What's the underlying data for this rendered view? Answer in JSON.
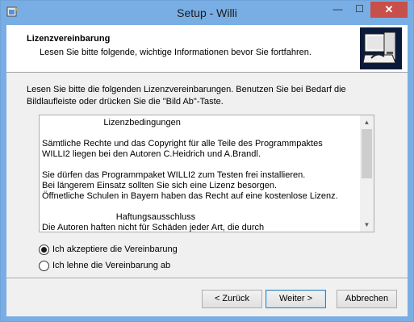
{
  "window": {
    "title": "Setup - Willi",
    "controls": {
      "minimize": "—",
      "maximize": "☐",
      "close": "✕"
    }
  },
  "header": {
    "title": "Lizenzvereinbarung",
    "subtitle": "Lesen Sie bitte folgende, wichtige Informationen bevor Sie fortfahren."
  },
  "instruction": "Lesen Sie bitte die folgenden Lizenzvereinbarungen. Benutzen Sie bei Bedarf die Bildlaufleiste oder drücken Sie die \"Bild Ab\"-Taste.",
  "license": {
    "text": "                         Lizenzbedingungen\n\nSämtliche Rechte und das Copyright für alle Teile des Programmpaktes\nWILLI2 liegen bei den Autoren C.Heidrich und A.Brandl.\n\nSie dürfen das Programmpaket WILLI2 zum Testen frei installieren.\nBei längerem Einsatz sollten Sie sich eine Lizenz besorgen.\nÖffnetliche Schulen in Bayern haben das Recht auf eine kostenlose Lizenz.\n\n                              Haftungsausschluss\nDie Autoren haften nicht für Schäden jeder Art, die durch"
  },
  "options": [
    {
      "label": "Ich akzeptiere die Vereinbarung",
      "selected": true
    },
    {
      "label": "Ich lehne die Vereinbarung ab",
      "selected": false
    }
  ],
  "buttons": {
    "back": "< Zurück",
    "next": "Weiter >",
    "cancel": "Abbrechen"
  },
  "icons": {
    "app": "installer-icon",
    "header": "computer-install-icon",
    "scroll_up": "chevron-up-icon",
    "scroll_down": "chevron-down-icon"
  },
  "colors": {
    "titlebar": "#79aee4",
    "close": "#c7504a",
    "default_button_border": "#3c7fb1"
  }
}
